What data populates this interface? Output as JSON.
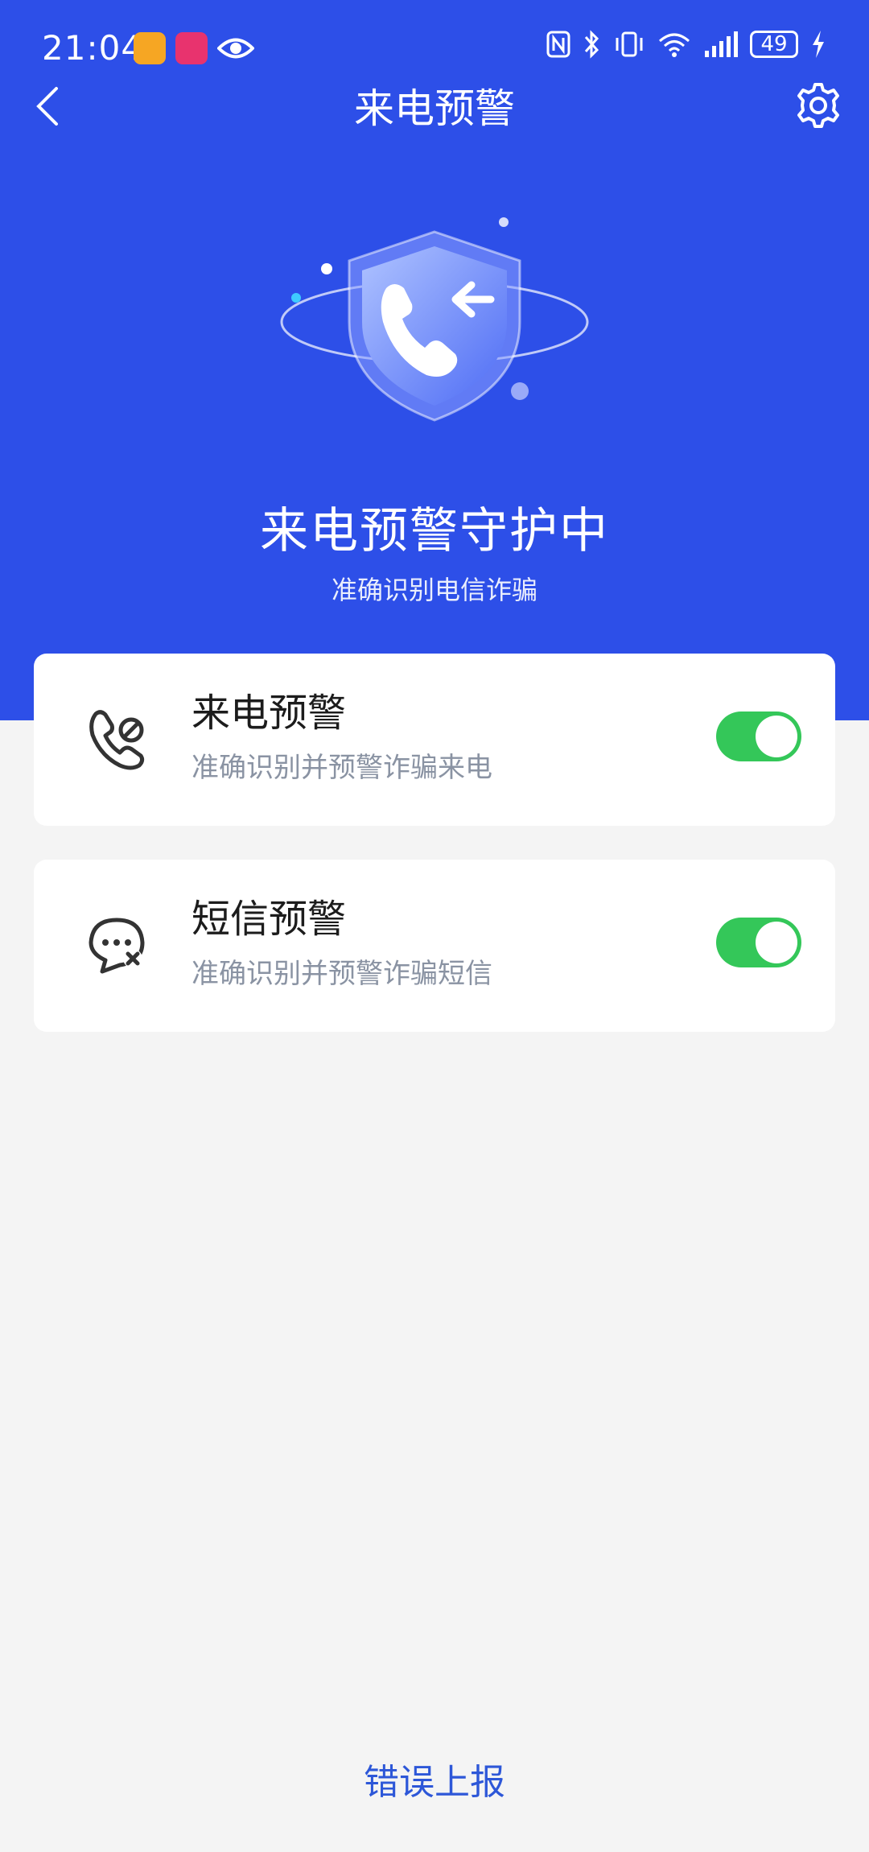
{
  "status_bar": {
    "time": "21:04",
    "battery": "49",
    "icons": [
      "weibo-app-icon",
      "pink-app-icon",
      "eye-icon",
      "nfc-icon",
      "bluetooth-icon",
      "vibrate-icon",
      "wifi-icon",
      "signal-icon",
      "battery-icon",
      "charging-icon"
    ]
  },
  "header": {
    "title": "来电预警",
    "back_icon": "back-arrow-icon",
    "settings_icon": "gear-icon"
  },
  "hero": {
    "title": "来电预警守护中",
    "subtitle": "准确识别电信诈骗",
    "illustration": "shield-phone-icon"
  },
  "cards": [
    {
      "title": "来电预警",
      "description": "准确识别并预警诈骗来电",
      "icon": "phone-block-icon",
      "enabled": true
    },
    {
      "title": "短信预警",
      "description": "准确识别并预警诈骗短信",
      "icon": "message-block-icon",
      "enabled": true
    }
  ],
  "footer": {
    "error_report": "错误上报"
  },
  "colors": {
    "primary": "#2D4FE8",
    "toggle_on": "#34C759",
    "background": "#F4F4F4",
    "link": "#2D57D8"
  }
}
